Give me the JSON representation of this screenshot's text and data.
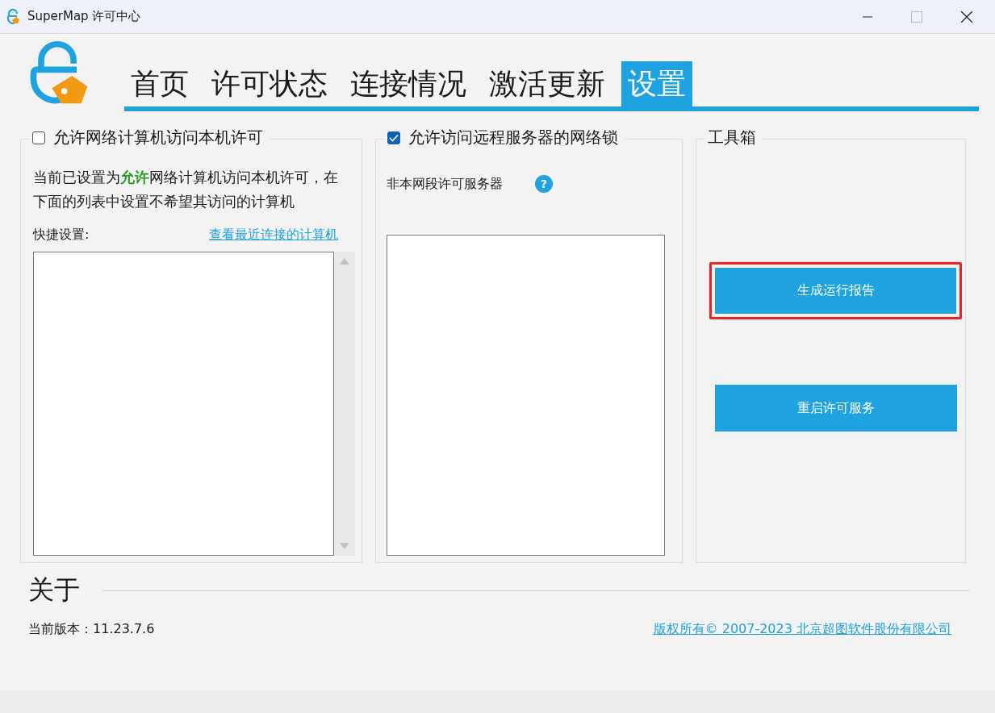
{
  "window": {
    "title": "SuperMap 许可中心"
  },
  "tabs": [
    {
      "label": "首页",
      "selected": false
    },
    {
      "label": "许可状态",
      "selected": false
    },
    {
      "label": "连接情况",
      "selected": false
    },
    {
      "label": "激活更新",
      "selected": false
    },
    {
      "label": "设置",
      "selected": true
    }
  ],
  "local_access": {
    "label": "允许网络计算机访问本机许可",
    "checked": false,
    "description": "当前已设置为**允许**网络计算机访问本机许可，在下面的列表中设置不希望其访问的计算机",
    "quick_label": "快捷设置:",
    "recent_link": "查看最近连接的计算机"
  },
  "remote_access": {
    "label": "允许访问远程服务器的网络锁",
    "checked": true,
    "servers_label": "非本网段许可服务器",
    "help_icon": "?"
  },
  "toolbox": {
    "title": "工具箱",
    "buttons": [
      {
        "label": "生成运行报告",
        "highlighted": true
      },
      {
        "label": "重启许可服务",
        "highlighted": false
      }
    ]
  },
  "about": {
    "title": "关于",
    "version": "当前版本：11.23.7.6",
    "copyright": "版权所有© 2007-2023 北京超图软件股份有限公司"
  }
}
